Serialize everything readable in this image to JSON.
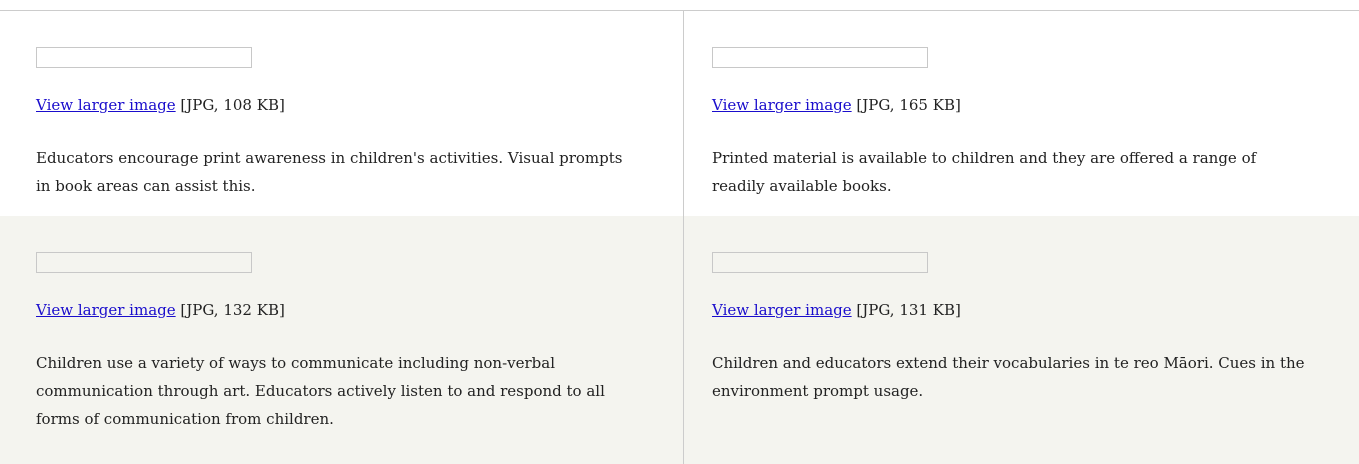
{
  "gallery": {
    "items": [
      {
        "link_label": "View larger image",
        "file_info": "[JPG, 108 KB]",
        "description": "Educators encourage print awareness in children's activities. Visual prompts in book areas can assist this."
      },
      {
        "link_label": "View larger image",
        "file_info": "[JPG, 165 KB]",
        "description": "Printed material is available to children and they are offered a range of readily available books."
      },
      {
        "link_label": "View larger image",
        "file_info": "[JPG, 132 KB]",
        "description": "Children use a variety of ways to communicate including non-verbal communication through art. Educators actively listen to and respond to all forms of communication from children."
      },
      {
        "link_label": "View larger image",
        "file_info": "[JPG, 131 KB]",
        "description": "Children and educators extend their vocabularies in te reo Māori. Cues in the environment prompt usage."
      }
    ]
  },
  "colors": {
    "link": "#1a0dcc",
    "alt_row_background": "#f4f4ef",
    "divider": "#cccccc"
  }
}
